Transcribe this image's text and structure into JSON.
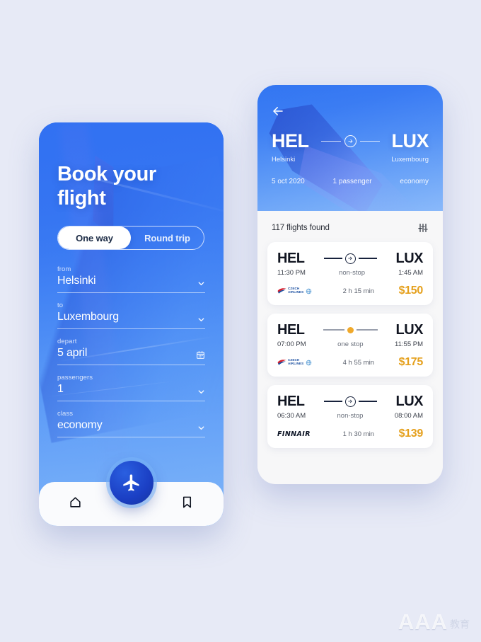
{
  "page": {
    "background_color": "#e7eaf6",
    "watermark": {
      "text": "AAA",
      "subtext": "教育"
    }
  },
  "colors": {
    "accent_blue": "#2f74f2",
    "deep_blue": "#1b3fc4",
    "price_gold": "#e5a01c",
    "stop_orange": "#f0a92b",
    "dark_text": "#111521"
  },
  "booking_screen": {
    "title": "Book your flight",
    "trip_type": {
      "options": [
        {
          "label": "One way",
          "active": true
        },
        {
          "label": "Round trip",
          "active": false
        }
      ]
    },
    "fields": [
      {
        "label": "from",
        "value": "Helsinki",
        "icon": "chevron-down-icon"
      },
      {
        "label": "to",
        "value": "Luxembourg",
        "icon": "chevron-down-icon"
      },
      {
        "label": "depart",
        "value": "5 april",
        "icon": "calendar-icon"
      },
      {
        "label": "passengers",
        "value": "1",
        "icon": "chevron-down-icon"
      },
      {
        "label": "class",
        "value": "economy",
        "icon": "chevron-down-icon"
      }
    ],
    "bottom_nav": {
      "home_icon": "home-icon",
      "fab_icon": "airplane-icon",
      "bookmark_icon": "bookmark-icon"
    }
  },
  "results_screen": {
    "back_icon": "back-arrow-icon",
    "route": {
      "origin_code": "HEL",
      "origin_city": "Helsinki",
      "destination_code": "LUX",
      "destination_city": "Luxembourg",
      "arrow_icon": "arrow-right-circle-icon"
    },
    "meta": {
      "date": "5 oct 2020",
      "passengers": "1 passenger",
      "class": "economy"
    },
    "results_header": {
      "count_text": "117 flights found",
      "filter_icon": "filter-sliders-icon"
    },
    "flights": [
      {
        "origin_code": "HEL",
        "destination_code": "LUX",
        "depart_time": "11:30 PM",
        "arrive_time": "1:45 AM",
        "stops": "non-stop",
        "duration": "2 h 15 min",
        "price": "$150",
        "airline": "CZECH AIRLINES",
        "airline_logo": "czech-airlines-logo"
      },
      {
        "origin_code": "HEL",
        "destination_code": "LUX",
        "depart_time": "07:00 PM",
        "arrive_time": "11:55 PM",
        "stops": "one stop",
        "duration": "4 h 55 min",
        "price": "$175",
        "airline": "CZECH AIRLINES",
        "airline_logo": "czech-airlines-logo"
      },
      {
        "origin_code": "HEL",
        "destination_code": "LUX",
        "depart_time": "06:30 AM",
        "arrive_time": "08:00 AM",
        "stops": "non-stop",
        "duration": "1 h 30 min",
        "price": "$139",
        "airline": "FINNAIR",
        "airline_logo": "finnair-logo"
      }
    ]
  }
}
